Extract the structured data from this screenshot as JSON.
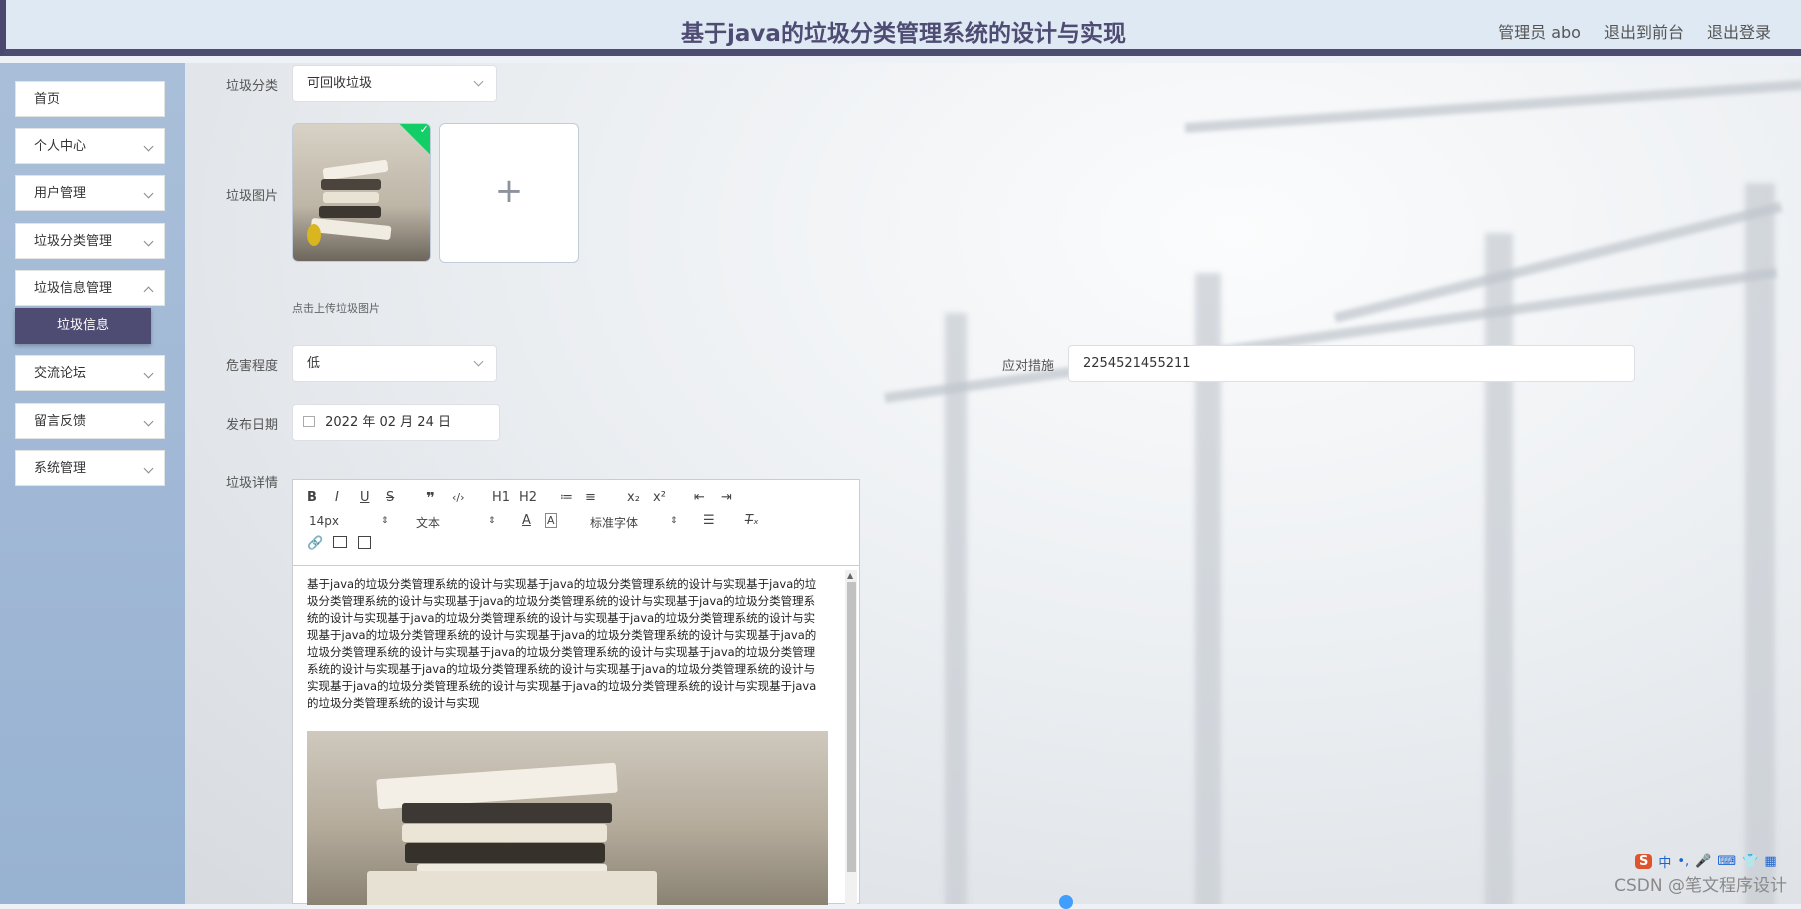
{
  "header": {
    "title": "基于java的垃圾分类管理系统的设计与实现",
    "links": [
      "管理员 abo",
      "退出到前台",
      "退出登录"
    ]
  },
  "sidebar": {
    "items": [
      {
        "label": "首页",
        "has_arrow": false
      },
      {
        "label": "个人中心",
        "has_arrow": true
      },
      {
        "label": "用户管理",
        "has_arrow": true
      },
      {
        "label": "垃圾分类管理",
        "has_arrow": true
      },
      {
        "label": "垃圾信息管理",
        "has_arrow": true
      },
      {
        "label": "交流论坛",
        "has_arrow": true
      },
      {
        "label": "留言反馈",
        "has_arrow": true
      },
      {
        "label": "系统管理",
        "has_arrow": true
      }
    ],
    "active_sub": "垃圾信息"
  },
  "form": {
    "category": {
      "label": "垃圾分类",
      "value": "可回收垃圾"
    },
    "image": {
      "label": "垃圾图片",
      "hint": "点击上传垃圾图片",
      "add_icon": "+"
    },
    "danger": {
      "label": "危害程度",
      "value": "低"
    },
    "measure": {
      "label": "应对措施",
      "value": "2254521455211"
    },
    "date": {
      "label": "发布日期",
      "value": "2022 年 02 月 24 日"
    },
    "detail": {
      "label": "垃圾详情"
    }
  },
  "editor": {
    "toolbar": {
      "row1": [
        "B",
        "I",
        "U",
        "S",
        "❞",
        "‹/›",
        "H1",
        "H2",
        "≔",
        "≡",
        "x₂",
        "x²",
        "⇤",
        "⇥"
      ],
      "font_size": "14px",
      "text_type": "文本",
      "font_family": "标准字体"
    },
    "content": "基于java的垃圾分类管理系统的设计与实现基于java的垃圾分类管理系统的设计与实现基于java的垃圾分类管理系统的设计与实现基于java的垃圾分类管理系统的设计与实现基于java的垃圾分类管理系统的设计与实现基于java的垃圾分类管理系统的设计与实现基于java的垃圾分类管理系统的设计与实现基于java的垃圾分类管理系统的设计与实现基于java的垃圾分类管理系统的设计与实现基于java的垃圾分类管理系统的设计与实现基于java的垃圾分类管理系统的设计与实现基于java的垃圾分类管理系统的设计与实现基于java的垃圾分类管理系统的设计与实现基于java的垃圾分类管理系统的设计与实现基于java的垃圾分类管理系统的设计与实现基于java的垃圾分类管理系统的设计与实现基于java的垃圾分类管理系统的设计与实现"
  },
  "watermark": "CSDN @笔文程序设计",
  "ime": {
    "brand": "S",
    "items": [
      "中",
      "•,",
      "🎤",
      "⌨",
      "👕",
      "▦"
    ]
  },
  "colors": {
    "accent": "#4e4c73",
    "header_bg": "#dfe9f3",
    "sidebar_bg": "#a9bfd9",
    "success": "#13ce66"
  }
}
